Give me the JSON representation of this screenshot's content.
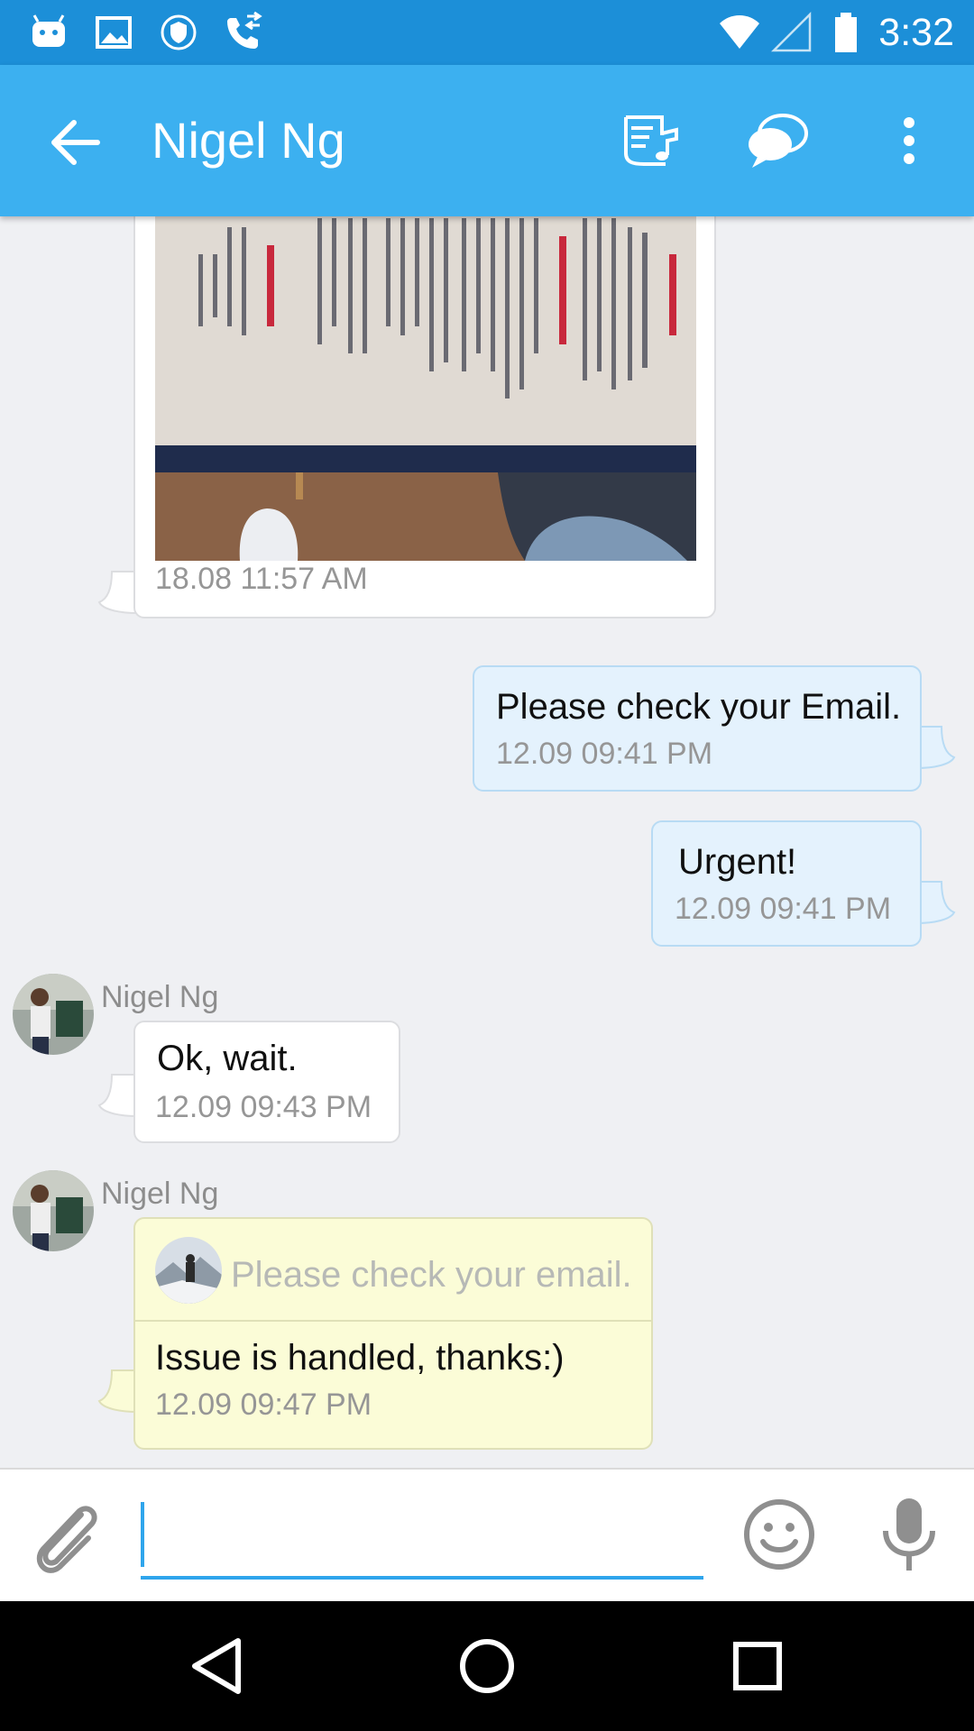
{
  "status_bar": {
    "time": "3:32"
  },
  "app_bar": {
    "title": "Nigel Ng"
  },
  "messages": [
    {
      "direction": "in",
      "kind": "image",
      "timestamp": "18.08 11:57 AM"
    },
    {
      "direction": "out",
      "text": "Please check your Email.",
      "timestamp": "12.09 09:41 PM"
    },
    {
      "direction": "out",
      "text": "Urgent!",
      "timestamp": "12.09 09:41 PM"
    },
    {
      "direction": "in",
      "sender": "Nigel Ng",
      "text": "Ok, wait.",
      "timestamp": "12.09 09:43 PM"
    },
    {
      "direction": "in",
      "sender": "Nigel Ng",
      "quoted_text": "Please check your email.",
      "text": "Issue is handled, thanks:)",
      "timestamp": "12.09 09:47 PM"
    }
  ],
  "input": {
    "value": "",
    "placeholder": ""
  },
  "icons": {
    "status": [
      "android-icon",
      "gallery-icon",
      "vpn-shield-icon",
      "phone-transfer-icon",
      "wifi-icon",
      "signal-icon",
      "battery-icon"
    ],
    "app_bar": [
      "back-arrow-icon",
      "music-note-icon",
      "chat-bubbles-icon",
      "overflow-menu-icon"
    ],
    "input_bar": [
      "paperclip-icon",
      "emoji-icon",
      "microphone-icon"
    ],
    "nav": [
      "nav-back-icon",
      "nav-home-icon",
      "nav-recents-icon"
    ]
  },
  "colors": {
    "status_bar": "#1c8fd8",
    "app_bar": "#3cb0f0",
    "background": "#eff0f3",
    "outgoing_bubble": "#e4f2fd",
    "quote_bubble": "#fbfcd7",
    "accent": "#2fa5ec"
  }
}
